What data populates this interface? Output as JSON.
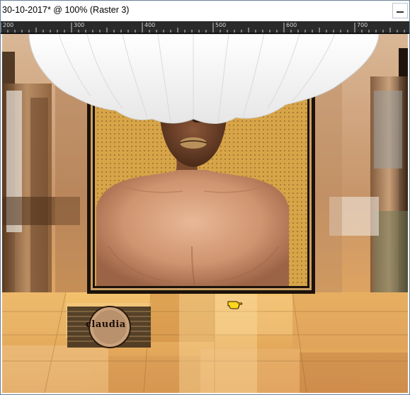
{
  "window": {
    "title": "30-10-2017* @ 100% (Raster 3)"
  },
  "ruler": {
    "labels": [
      "200",
      "300",
      "400",
      "500",
      "600",
      "700"
    ]
  },
  "icons": {
    "minimize": "minimize-icon",
    "cursor": "pointing-hand-cursor-icon"
  },
  "canvas": {
    "signature_text": "claudia"
  },
  "colors": {
    "ruler_bg": "#2a2a2a",
    "frame_gold": "#c9993f",
    "shadow": "#1c120a",
    "window_border": "#6b7f99"
  }
}
